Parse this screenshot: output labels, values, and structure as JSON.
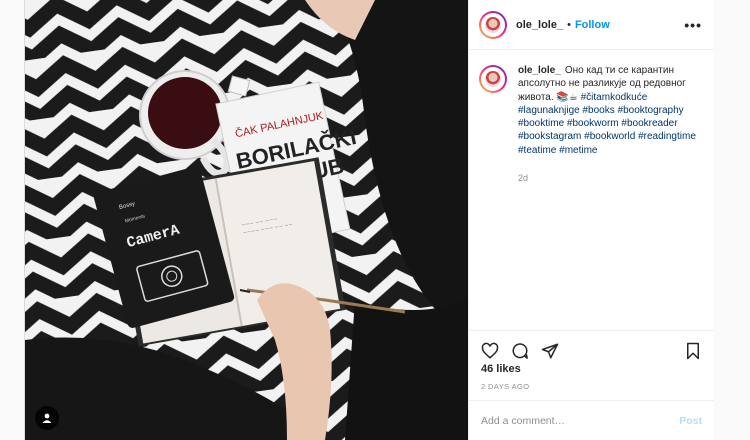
{
  "author": {
    "username": "ole_lole_",
    "follow_label": "Follow",
    "separator": "•"
  },
  "caption": {
    "username": "ole_lole_",
    "text": "Оно кад ти се карантин апсолутно не разликује од редовног живота. 📚☕",
    "hashtags": "#čitamkodkuće #lagunaknjige #books #booktography #booktime #bookworm #bookreader #bookstagram #bookworld #readingtime #teatime #metime",
    "age": "2d"
  },
  "photo": {
    "book_author": "ČAK PALAHNJUK",
    "book_title_1": "BORILAČKI",
    "book_title_2": "KLUB",
    "notebook_brand": "CamerA",
    "notebook_small_1": "Bossy",
    "notebook_small_2": "Moments"
  },
  "stats": {
    "likes": "46 likes",
    "posted": "2 DAYS AGO"
  },
  "comment_box": {
    "placeholder": "Add a comment…",
    "post_label": "Post"
  },
  "icons": {
    "more": "more-options-icon",
    "like": "heart-icon",
    "comment": "comment-icon",
    "share": "share-icon",
    "save": "bookmark-icon",
    "tag": "user-tag-icon"
  }
}
